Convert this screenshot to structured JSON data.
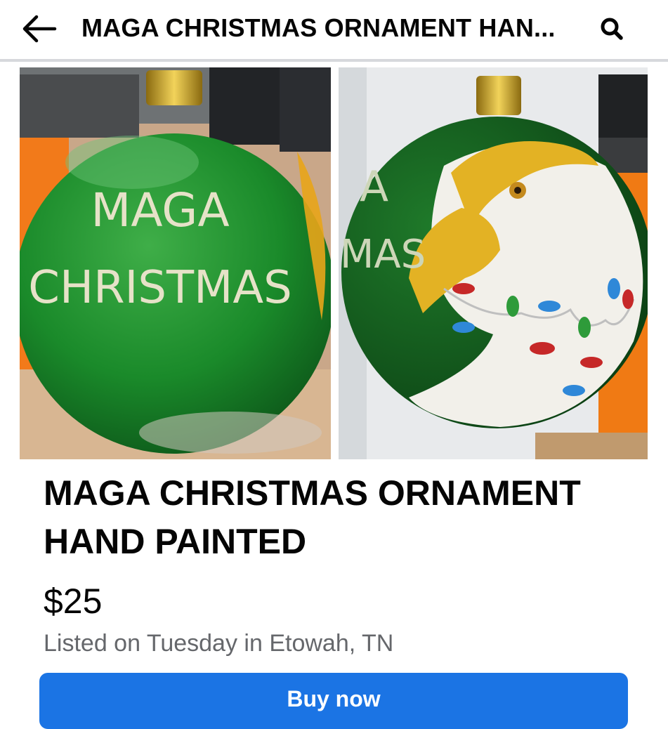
{
  "header": {
    "title": "MAGA CHRISTMAS ORNAMENT HAN...",
    "back_icon": "arrow-left-icon",
    "search_icon": "search-icon"
  },
  "gallery": {
    "photos": [
      {
        "ornament_text_line1": "MAGA",
        "ornament_text_line2": "CHRISTMAS"
      },
      {
        "ornament_text_partial_line1": "A",
        "ornament_text_partial_line2": "MAS"
      }
    ]
  },
  "listing": {
    "title": "MAGA CHRISTMAS ORNAMENT HAND PAINTED",
    "price": "$25",
    "listed": "Listed on Tuesday in Etowah, TN"
  },
  "actions": {
    "buy_label": "Buy now"
  },
  "colors": {
    "accent": "#1b74e4",
    "text_primary": "#050505",
    "text_secondary": "#65676b",
    "ornament_green": "#1f8a2c"
  }
}
